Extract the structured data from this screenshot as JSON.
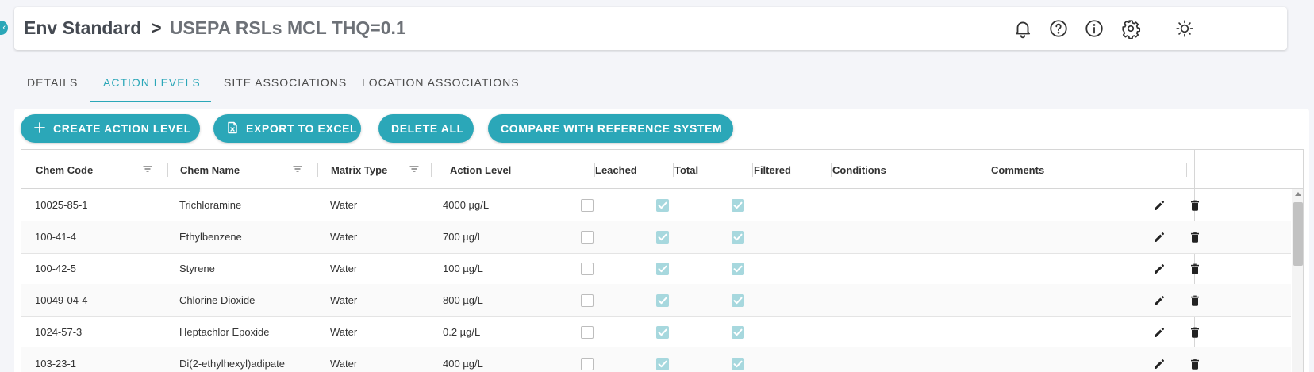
{
  "breadcrumb": {
    "root": "Env Standard",
    "separator": ">",
    "current": "USEPA RSLs MCL THQ=0.1"
  },
  "header_icons": [
    "bell-icon",
    "help-icon",
    "info-icon",
    "gear-icon",
    "brightness-icon"
  ],
  "tabs": [
    {
      "label": "DETAILS",
      "active": false
    },
    {
      "label": "ACTION LEVELS",
      "active": true
    },
    {
      "label": "SITE ASSOCIATIONS",
      "active": false
    },
    {
      "label": "LOCATION ASSOCIATIONS",
      "active": false
    }
  ],
  "toolbar": {
    "create": "CREATE ACTION LEVEL",
    "export": "EXPORT TO EXCEL",
    "delete_all": "DELETE ALL",
    "compare": "COMPARE WITH REFERENCE SYSTEM"
  },
  "table": {
    "columns": [
      "Chem Code",
      "Chem Name",
      "Matrix Type",
      "Action Level",
      "Leached",
      "Total",
      "Filtered",
      "Conditions",
      "Comments"
    ],
    "rows": [
      {
        "chem_code": "10025-85-1",
        "chem_name": "Trichloramine",
        "matrix": "Water",
        "action_level": "4000 µg/L",
        "leached": false,
        "total": true,
        "filtered": true,
        "conditions": "",
        "comments": ""
      },
      {
        "chem_code": "100-41-4",
        "chem_name": "Ethylbenzene",
        "matrix": "Water",
        "action_level": "700 µg/L",
        "leached": false,
        "total": true,
        "filtered": true,
        "conditions": "",
        "comments": ""
      },
      {
        "chem_code": "100-42-5",
        "chem_name": "Styrene",
        "matrix": "Water",
        "action_level": "100 µg/L",
        "leached": false,
        "total": true,
        "filtered": true,
        "conditions": "",
        "comments": ""
      },
      {
        "chem_code": "10049-04-4",
        "chem_name": "Chlorine Dioxide",
        "matrix": "Water",
        "action_level": "800 µg/L",
        "leached": false,
        "total": true,
        "filtered": true,
        "conditions": "",
        "comments": ""
      },
      {
        "chem_code": "1024-57-3",
        "chem_name": "Heptachlor Epoxide",
        "matrix": "Water",
        "action_level": "0.2 µg/L",
        "leached": false,
        "total": true,
        "filtered": true,
        "conditions": "",
        "comments": ""
      },
      {
        "chem_code": "103-23-1",
        "chem_name": "Di(2-ethylhexyl)adipate",
        "matrix": "Water",
        "action_level": "400 µg/L",
        "leached": false,
        "total": true,
        "filtered": true,
        "conditions": "",
        "comments": ""
      }
    ]
  },
  "colors": {
    "accent": "#2ba7b8",
    "checked_fill": "#a7d8de"
  }
}
